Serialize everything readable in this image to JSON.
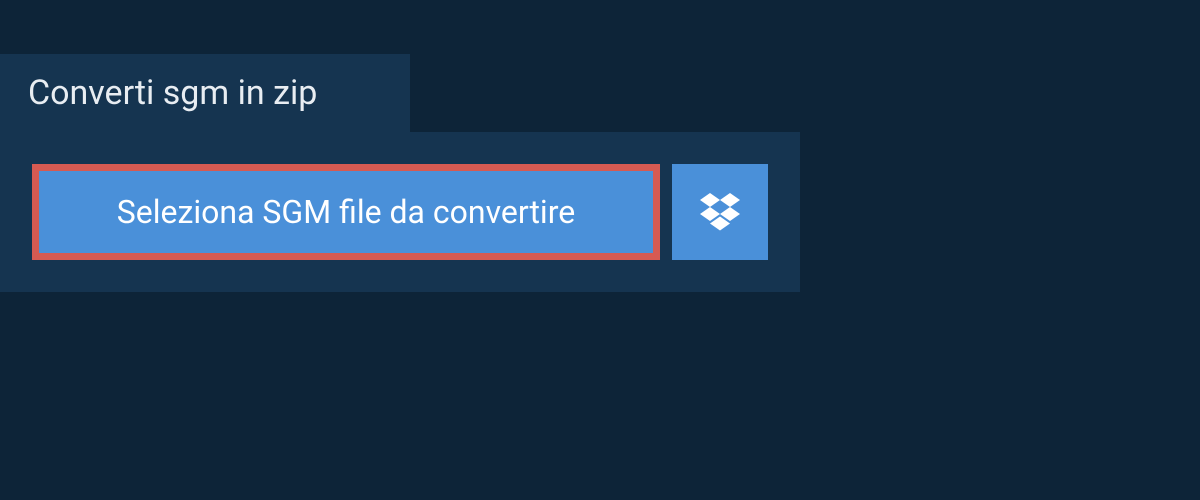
{
  "tab": {
    "title": "Converti sgm in zip"
  },
  "buttons": {
    "select_label": "Seleziona SGM file da convertire"
  },
  "colors": {
    "background": "#0d2438",
    "panel": "#153450",
    "button": "#4a90d9",
    "highlight_border": "#d65a52"
  }
}
